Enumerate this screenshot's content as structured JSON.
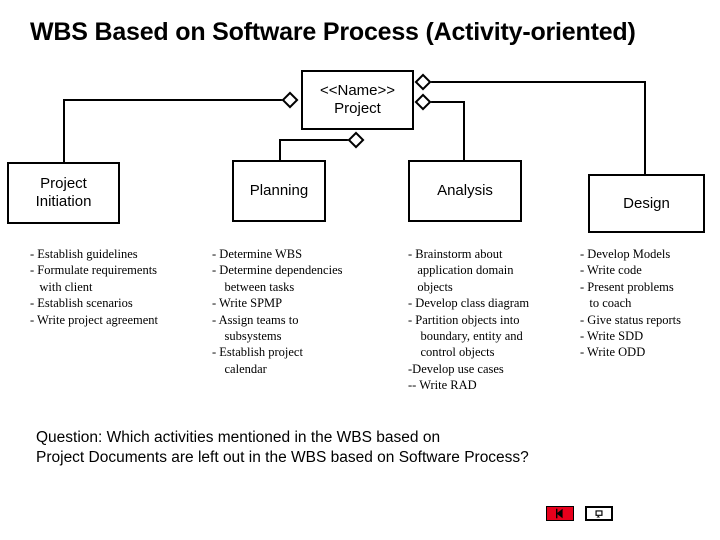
{
  "slide": {
    "title": "WBS Based on Software Process  (Activity-oriented)"
  },
  "diagram": {
    "root": {
      "line1": "<<Name>>",
      "line2": "Project"
    },
    "nodes": {
      "initiation": "Project\nInitiation",
      "initiation_line1": "Project",
      "initiation_line2": "Initiation",
      "planning": "Planning",
      "analysis": "Analysis",
      "design": "Design"
    }
  },
  "columns": [
    {
      "name": "project-initiation-activities",
      "items": [
        "- Establish guidelines",
        "- Formulate requirements",
        "   with client",
        "- Establish scenarios",
        "- Write project agreement"
      ]
    },
    {
      "name": "planning-activities",
      "items": [
        "- Determine WBS",
        "- Determine dependencies",
        "    between tasks",
        "- Write SPMP",
        "- Assign teams to",
        "    subsystems",
        "- Establish project",
        "    calendar"
      ]
    },
    {
      "name": "analysis-activities",
      "items": [
        "- Brainstorm about",
        "   application domain",
        "   objects",
        "- Develop class diagram",
        "- Partition objects into",
        "    boundary, entity and",
        "    control objects",
        "-Develop use cases",
        "-- Write RAD"
      ]
    },
    {
      "name": "design-activities",
      "items": [
        "- Develop Models",
        "- Write code",
        "- Present problems",
        "   to coach",
        "- Give status reports",
        "- Write SDD",
        "- Write ODD"
      ]
    }
  ],
  "question": {
    "line1": "Question: Which activities mentioned in the WBS based on",
    "line2": "Project Documents are left out in the WBS based on Software Process?"
  },
  "action_buttons": [
    {
      "name": "previous-slide-action-button",
      "style": "red",
      "glyph": "◀"
    },
    {
      "name": "return-action-button",
      "style": "white",
      "glyph": "↺"
    }
  ],
  "colors": {
    "stroke": "#000000",
    "background": "#ffffff",
    "action_button_red": "#e8001c"
  }
}
